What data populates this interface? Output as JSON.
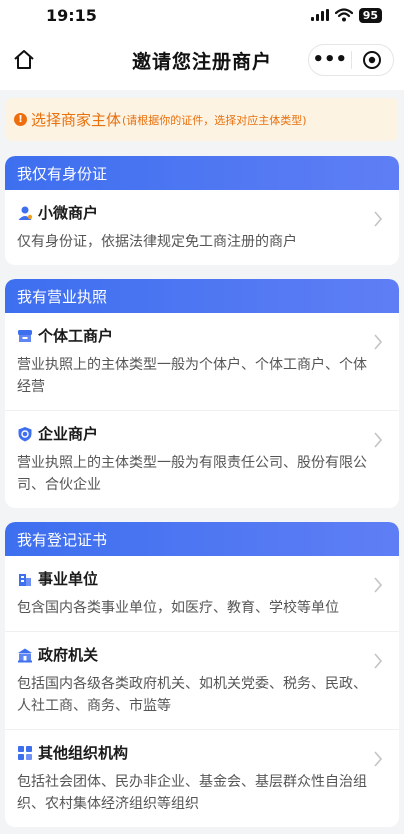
{
  "status": {
    "time": "19:15",
    "battery": "95"
  },
  "nav": {
    "title": "邀请您注册商户",
    "more": "•••"
  },
  "notice": {
    "main": "选择商家主体",
    "sub": "(请根据你的证件，选择对应主体类型)"
  },
  "sections": [
    {
      "header": "我仅有身份证",
      "items": [
        {
          "icon": "person-icon",
          "title": "小微商户",
          "desc": "仅有身份证，依据法律规定免工商注册的商户"
        }
      ]
    },
    {
      "header": "我有营业执照",
      "items": [
        {
          "icon": "store-icon",
          "title": "个体工商户",
          "desc": "营业执照上的主体类型一般为个体户、个体工商户、个体经营"
        },
        {
          "icon": "enterprise-shield-icon",
          "title": "企业商户",
          "desc": "营业执照上的主体类型一般为有限责任公司、股份有限公司、合伙企业"
        }
      ]
    },
    {
      "header": "我有登记证书",
      "items": [
        {
          "icon": "building-icon",
          "title": "事业单位",
          "desc": "包含国内各类事业单位，如医疗、教育、学校等单位"
        },
        {
          "icon": "government-icon",
          "title": "政府机关",
          "desc": "包括国内各级各类政府机关、如机关党委、税务、民政、人社工商、商务、市监等"
        },
        {
          "icon": "grid-icon",
          "title": "其他组织机构",
          "desc": "包括社会团体、民办非企业、基金会、基层群众性自治组织、农村集体经济组织等组织"
        }
      ]
    }
  ],
  "colors": {
    "accent": "#3d6fef",
    "notice_text": "#e8700d",
    "notice_bg": "#fdf3e3"
  }
}
